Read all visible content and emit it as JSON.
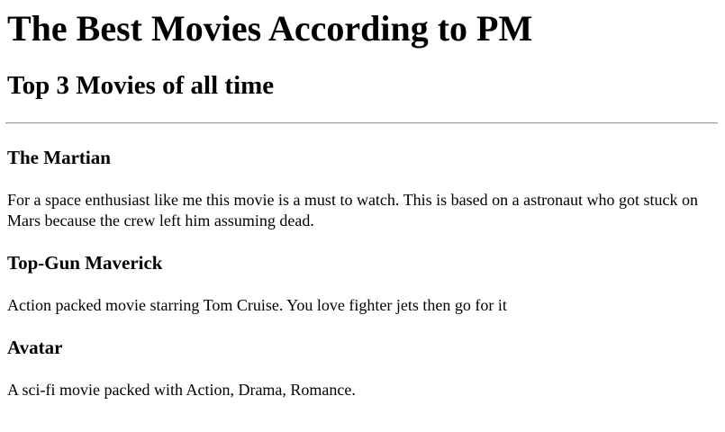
{
  "page": {
    "title": "The Best Movies According to PM",
    "subtitle": "Top 3 Movies of all time"
  },
  "movies": [
    {
      "title": "The Martian",
      "description": "For a space enthusiast like me this movie is a must to watch. This is based on a astronaut who got stuck on Mars because the crew left him assuming dead."
    },
    {
      "title": "Top-Gun Maverick",
      "description": "Action packed movie starring Tom Cruise. You love fighter jets then go for it"
    },
    {
      "title": "Avatar",
      "description": "A sci-fi movie packed with Action, Drama, Romance."
    }
  ]
}
